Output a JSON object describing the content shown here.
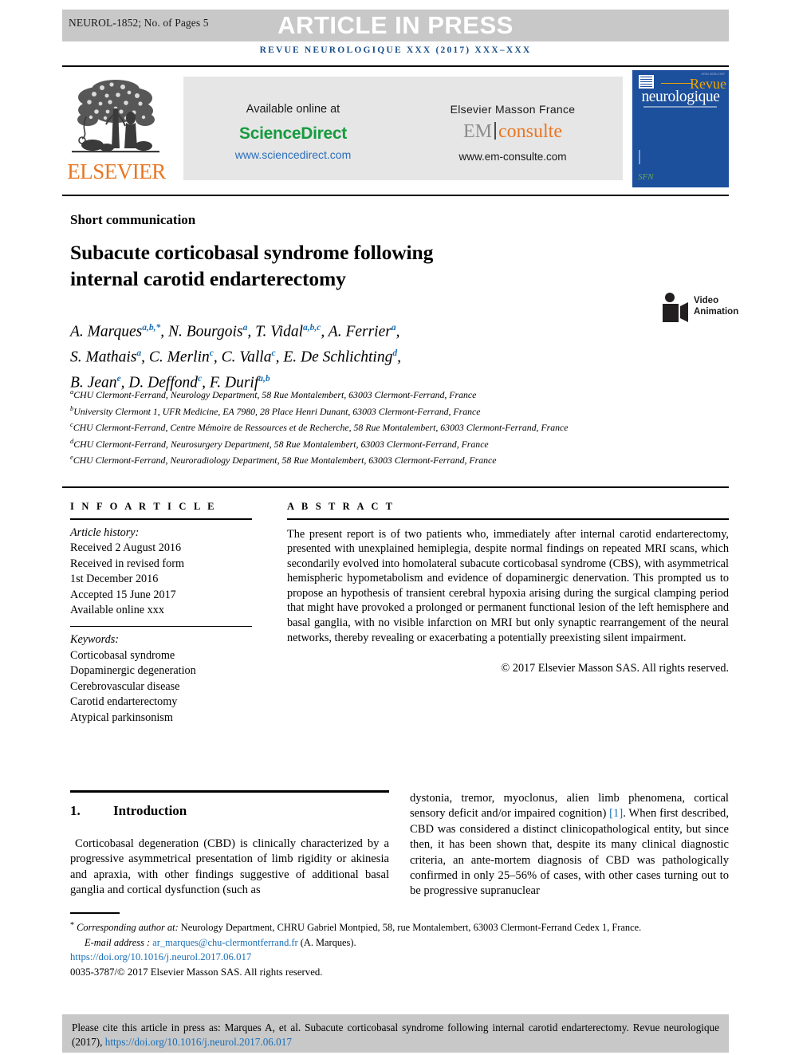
{
  "banner": {
    "journal_code": "NEUROL-1852; No. of Pages 5",
    "title": "ARTICLE IN PRESS",
    "running_head": "REVUE NEUROLOGIQUE XXX (2017) XXX–XXX"
  },
  "masthead": {
    "elsevier_wordmark": "ELSEVIER",
    "available_online": "Available online at",
    "sciencedirect": "ScienceDirect",
    "sciencedirect_url": "www.sciencedirect.com",
    "elsevier_masson": "Elsevier Masson France",
    "em_prefix": "EM",
    "em_suffix": "consulte",
    "em_url": "www.em-consulte.com",
    "cover_revue": "Revue",
    "cover_neurologique": "neurologique"
  },
  "article": {
    "type": "Short communication",
    "title_line1": "Subacute corticobasal syndrome following",
    "title_line2": "internal carotid endarterectomy",
    "video_badge_line1": "Video",
    "video_badge_line2": "Animation"
  },
  "authors": {
    "list": [
      {
        "name": "A. Marques",
        "sup": "a,b,*",
        "sep": ", "
      },
      {
        "name": "N. Bourgois",
        "sup": "a",
        "sep": ", "
      },
      {
        "name": "T. Vidal",
        "sup": "a,b,c",
        "sep": ", "
      },
      {
        "name": "A. Ferrier",
        "sup": "a",
        "sep": ", "
      },
      {
        "name": "S. Mathais",
        "sup": "a",
        "sep": ", "
      },
      {
        "name": "C. Merlin",
        "sup": "c",
        "sep": ", "
      },
      {
        "name": "C. Valla",
        "sup": "c",
        "sep": ", "
      },
      {
        "name": "E. De Schlichting",
        "sup": "d",
        "sep": ", "
      },
      {
        "name": "B. Jean",
        "sup": "e",
        "sep": ", "
      },
      {
        "name": "D. Deffond",
        "sup": "c",
        "sep": ", "
      },
      {
        "name": "F. Durif",
        "sup": "a,b",
        "sep": ""
      }
    ]
  },
  "affiliations": [
    {
      "marker": "a",
      "text": "CHU Clermont-Ferrand, Neurology Department, 58 Rue Montalembert, 63003 Clermont-Ferrand, France"
    },
    {
      "marker": "b",
      "text": "University Clermont 1, UFR Medicine, EA 7980, 28 Place Henri Dunant, 63003 Clermont-Ferrand, France"
    },
    {
      "marker": "c",
      "text": "CHU Clermont-Ferrand, Centre Mémoire de Ressources et de Recherche, 58 Rue Montalembert, 63003 Clermont-Ferrand, France"
    },
    {
      "marker": "d",
      "text": "CHU Clermont-Ferrand, Neurosurgery Department, 58 Rue Montalembert, 63003 Clermont-Ferrand, France"
    },
    {
      "marker": "e",
      "text": "CHU Clermont-Ferrand, Neuroradiology Department, 58 Rue Montalembert, 63003 Clermont-Ferrand, France"
    }
  ],
  "info": {
    "heading": "I N F O   A R T I C L E",
    "history_label": "Article history:",
    "history": [
      "Received 2 August 2016",
      "Received in revised form",
      "1st December 2016",
      "Accepted 15 June 2017",
      "Available online xxx"
    ],
    "keywords_label": "Keywords:",
    "keywords": [
      "Corticobasal syndrome",
      "Dopaminergic degeneration",
      "Cerebrovascular disease",
      "Carotid endarterectomy",
      "Atypical parkinsonism"
    ]
  },
  "abstract": {
    "heading": "A B S T R A C T",
    "text": "The present report is of two patients who, immediately after internal carotid endarterectomy, presented with unexplained hemiplegia, despite normal findings on repeated MRI scans, which secondarily evolved into homolateral subacute corticobasal syndrome (CBS), with asymmetrical hemispheric hypometabolism and evidence of dopaminergic denervation. This prompted us to propose an hypothesis of transient cerebral hypoxia arising during the surgical clamping period that might have provoked a prolonged or permanent functional lesion of the left hemisphere and basal ganglia, with no visible infarction on MRI but only synaptic rearrangement of the neural networks, thereby revealing or exacerbating a potentially preexisting silent impairment.",
    "copyright": "© 2017 Elsevier Masson SAS. All rights reserved."
  },
  "body": {
    "section_number": "1.",
    "section_title": "Introduction",
    "left_paragraph": "Corticobasal degeneration (CBD) is clinically characterized by a progressive asymmetrical presentation of limb rigidity or akinesia and apraxia, with other findings suggestive of additional basal ganglia and cortical dysfunction (such as",
    "right_part1": "dystonia, tremor, myoclonus, alien limb phenomena, cortical sensory deficit and/or impaired cognition) ",
    "right_citation": "[1]",
    "right_part2": ". When first described, CBD was considered a distinct clinicopathological entity, but since then, it has been shown that, despite its many clinical diagnostic criteria, an ante-mortem diagnosis of CBD was pathologically confirmed in only 25–56% of cases, with other cases turning out to be progressive supranuclear"
  },
  "footnotes": {
    "corr_marker": "*",
    "corr_label": "Corresponding author at:",
    "corr_text": " Neurology Department, CHRU Gabriel Montpied, 58, rue Montalembert, 63003 Clermont-Ferrand Cedex 1, France.",
    "email_label": "E-mail address :",
    "email": "ar_marques@chu-clermontferrand.fr",
    "email_suffix": " (A. Marques).",
    "doi": "https://doi.org/10.1016/j.neurol.2017.06.017",
    "issn": "0035-3787/© 2017 Elsevier Masson SAS. All rights reserved."
  },
  "cite_box": {
    "prefix": "Please cite this article in press as: Marques A, et al. Subacute corticobasal syndrome following internal carotid endarterectomy. Revue neurologique (2017), ",
    "doi": "https://doi.org/10.1016/j.neurol.2017.06.017"
  },
  "colors": {
    "banner_bg": "#c8c8c8",
    "running_head": "#1a4f8a",
    "elsevier_orange": "#e87722",
    "sciencedirect_green": "#169b3f",
    "link_blue": "#1a6fb5",
    "cover_blue": "#1c4f9c",
    "cover_gold": "#f0a500"
  }
}
